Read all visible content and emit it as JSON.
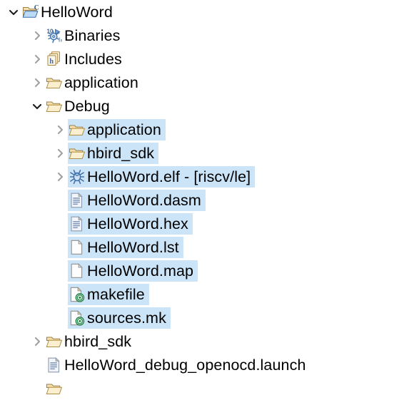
{
  "app": {
    "view_title": "Project Explorer",
    "selection_color": "#cce4f7",
    "background_color": "#ffffff",
    "text_color": "#000000"
  },
  "tree": {
    "nodes": [
      {
        "id": "helloword-project",
        "label": "HelloWord",
        "depth": 0,
        "twisty": "expanded",
        "icon": "c-project-folder-icon",
        "selected": false
      },
      {
        "id": "binaries",
        "label": "Binaries",
        "depth": 1,
        "twisty": "collapsed",
        "icon": "binaries-icon",
        "selected": false
      },
      {
        "id": "includes",
        "label": "Includes",
        "depth": 1,
        "twisty": "collapsed",
        "icon": "includes-icon",
        "selected": false
      },
      {
        "id": "application-src",
        "label": "application",
        "depth": 1,
        "twisty": "collapsed",
        "icon": "folder-icon",
        "selected": false
      },
      {
        "id": "debug",
        "label": "Debug",
        "depth": 1,
        "twisty": "expanded",
        "icon": "folder-icon",
        "selected": false
      },
      {
        "id": "debug-application",
        "label": "application",
        "depth": 2,
        "twisty": "collapsed",
        "icon": "folder-icon",
        "selected": true
      },
      {
        "id": "debug-hbird-sdk",
        "label": "hbird_sdk",
        "depth": 2,
        "twisty": "collapsed",
        "icon": "folder-icon",
        "selected": true
      },
      {
        "id": "helloword-elf",
        "label": "HelloWord.elf - [riscv/le]",
        "depth": 2,
        "twisty": "collapsed",
        "icon": "executable-bug-icon",
        "selected": true
      },
      {
        "id": "helloword-dasm",
        "label": "HelloWord.dasm",
        "depth": 2,
        "twisty": "none",
        "icon": "text-file-icon",
        "selected": true
      },
      {
        "id": "helloword-hex",
        "label": "HelloWord.hex",
        "depth": 2,
        "twisty": "none",
        "icon": "text-file-icon",
        "selected": true
      },
      {
        "id": "helloword-lst",
        "label": "HelloWord.lst",
        "depth": 2,
        "twisty": "none",
        "icon": "blank-file-icon",
        "selected": true
      },
      {
        "id": "helloword-map",
        "label": "HelloWord.map",
        "depth": 2,
        "twisty": "none",
        "icon": "blank-file-icon",
        "selected": true
      },
      {
        "id": "makefile",
        "label": "makefile",
        "depth": 2,
        "twisty": "none",
        "icon": "makefile-icon",
        "selected": true
      },
      {
        "id": "sources-mk",
        "label": "sources.mk",
        "depth": 2,
        "twisty": "none",
        "icon": "makefile-icon",
        "selected": true
      },
      {
        "id": "hbird-sdk",
        "label": "hbird_sdk",
        "depth": 1,
        "twisty": "collapsed",
        "icon": "folder-icon",
        "selected": false
      },
      {
        "id": "helloword-debug-openocd-launch",
        "label": "HelloWord_debug_openocd.launch",
        "depth": 1,
        "twisty": "none",
        "icon": "launch-file-icon",
        "selected": false
      },
      {
        "id": "partial-bottom-folder",
        "label": "",
        "depth": 1,
        "twisty": "none",
        "icon": "folder-icon",
        "selected": false
      }
    ]
  }
}
